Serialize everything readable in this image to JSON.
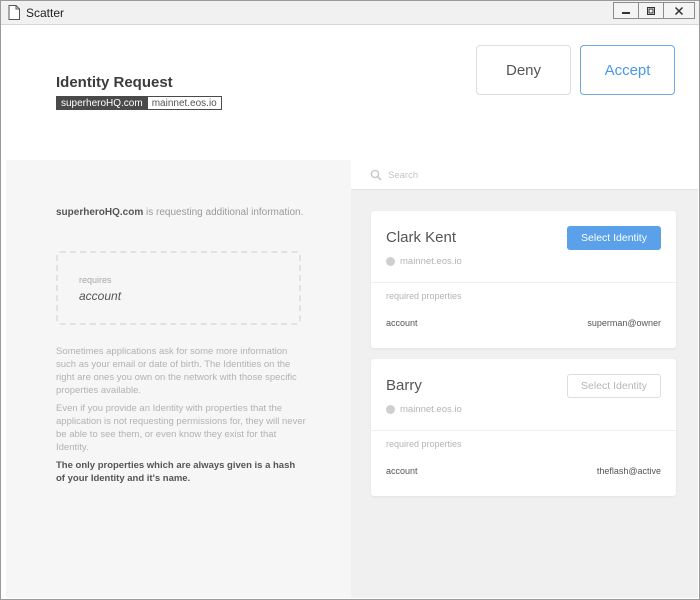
{
  "window": {
    "title": "Scatter"
  },
  "header": {
    "title": "Identity Request",
    "domain": "superheroHQ.com",
    "network": "mainnet.eos.io",
    "deny_label": "Deny",
    "accept_label": "Accept"
  },
  "left": {
    "requesting_domain": "superheroHQ.com",
    "requesting_text": " is requesting additional information.",
    "requires_label": "requires",
    "requires_value": "account",
    "info_1": "Sometimes applications ask for some more information such as your email or date of birth. The Identities on the right are ones you own on the network with those specific properties available.",
    "info_2": "Even if you provide an Identity with properties that the application is not requesting permissions for, they will never be able to see them, or even know they exist for that Identity.",
    "info_3": "The only properties which are always given is a hash of your Identity and it's name."
  },
  "search": {
    "placeholder": "Search"
  },
  "identities": [
    {
      "name": "Clark Kent",
      "network": "mainnet.eos.io",
      "button_label": "Select Identity",
      "required_label": "required properties",
      "property_key": "account",
      "property_value": "superman@owner"
    },
    {
      "name": "Barry",
      "network": "mainnet.eos.io",
      "button_label": "Select Identity",
      "required_label": "required properties",
      "property_key": "account",
      "property_value": "theflash@active"
    }
  ],
  "colors": {
    "accent": "#5aa1ea",
    "accept_text": "#4a98e8",
    "dark_tag": "#4a4a4a"
  }
}
